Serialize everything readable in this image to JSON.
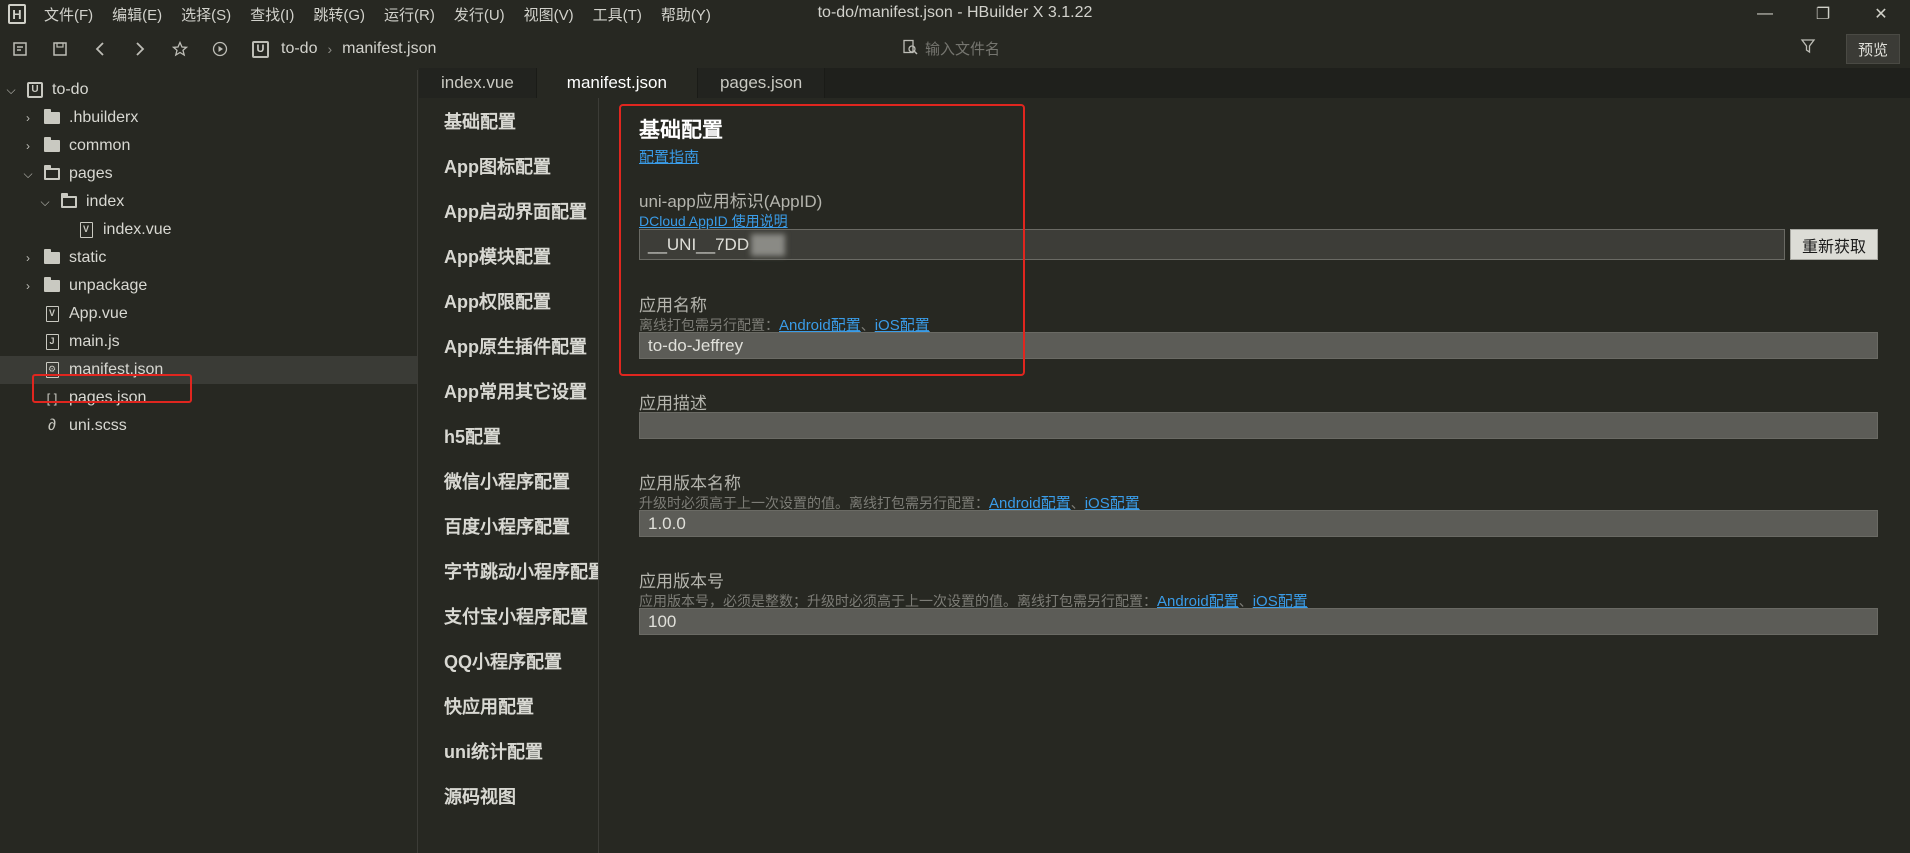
{
  "app": {
    "window_title": "to-do/manifest.json - HBuilder X 3.1.22",
    "logo_glyph": "H",
    "menu": [
      "文件(F)",
      "编辑(E)",
      "选择(S)",
      "查找(I)",
      "跳转(G)",
      "运行(R)",
      "发行(U)",
      "视图(V)",
      "工具(T)",
      "帮助(Y)"
    ]
  },
  "toolbar": {
    "breadcrumb": [
      "to-do",
      "manifest.json"
    ],
    "breadcrumb_icon_glyph": "U",
    "search_placeholder": "输入文件名",
    "preview_label": "预览"
  },
  "file_tree": [
    {
      "label": "to-do",
      "type": "project",
      "depth": 0,
      "expanded": true
    },
    {
      "label": ".hbuilderx",
      "type": "folder",
      "depth": 1,
      "expanded": false
    },
    {
      "label": "common",
      "type": "folder",
      "depth": 1,
      "expanded": false
    },
    {
      "label": "pages",
      "type": "folder",
      "depth": 1,
      "expanded": true
    },
    {
      "label": "index",
      "type": "folder",
      "depth": 2,
      "expanded": true
    },
    {
      "label": "index.vue",
      "type": "vue",
      "depth": 3
    },
    {
      "label": "static",
      "type": "folder",
      "depth": 1,
      "expanded": false
    },
    {
      "label": "unpackage",
      "type": "folder",
      "depth": 1,
      "expanded": false
    },
    {
      "label": "App.vue",
      "type": "vue",
      "depth": 1
    },
    {
      "label": "main.js",
      "type": "js",
      "depth": 1
    },
    {
      "label": "manifest.json",
      "type": "manifest",
      "depth": 1,
      "selected": true
    },
    {
      "label": "pages.json",
      "type": "json",
      "depth": 1
    },
    {
      "label": "uni.scss",
      "type": "scss",
      "depth": 1
    }
  ],
  "tabs": [
    {
      "label": "index.vue",
      "active": false
    },
    {
      "label": "manifest.json",
      "active": true
    },
    {
      "label": "pages.json",
      "active": false
    }
  ],
  "config_nav": [
    "基础配置",
    "App图标配置",
    "App启动界面配置",
    "App模块配置",
    "App权限配置",
    "App原生插件配置",
    "App常用其它设置",
    "h5配置",
    "微信小程序配置",
    "百度小程序配置",
    "字节跳动小程序配置",
    "支付宝小程序配置",
    "QQ小程序配置",
    "快应用配置",
    "uni统计配置",
    "源码视图"
  ],
  "basic": {
    "title": "基础配置",
    "guide_link": "配置指南",
    "appid": {
      "label": "uni-app应用标识(AppID)",
      "help_link": "DCloud AppID 使用说明",
      "value": "__UNI__7DD",
      "refetch_label": "重新获取"
    },
    "app_name": {
      "label": "应用名称",
      "hint": "离线打包需另行配置：",
      "android_link": "Android配置",
      "separator": "、",
      "ios_link": "iOS配置",
      "value": "to-do-Jeffrey"
    },
    "app_desc": {
      "label": "应用描述",
      "value": ""
    },
    "version_name": {
      "label": "应用版本名称",
      "hint": "升级时必须高于上一次设置的值。离线打包需另行配置：",
      "android_link": "Android配置",
      "separator": "、",
      "ios_link": "iOS配置",
      "value": "1.0.0"
    },
    "version_code": {
      "label": "应用版本号",
      "hint": "应用版本号，必须是整数；升级时必须高于上一次设置的值。离线打包需另行配置：",
      "android_link": "Android配置",
      "separator": "、",
      "ios_link": "iOS配置",
      "value": "100"
    }
  },
  "colors": {
    "background": "#272822",
    "link": "#3a9ce8",
    "highlight_outline": "#e0261f"
  }
}
